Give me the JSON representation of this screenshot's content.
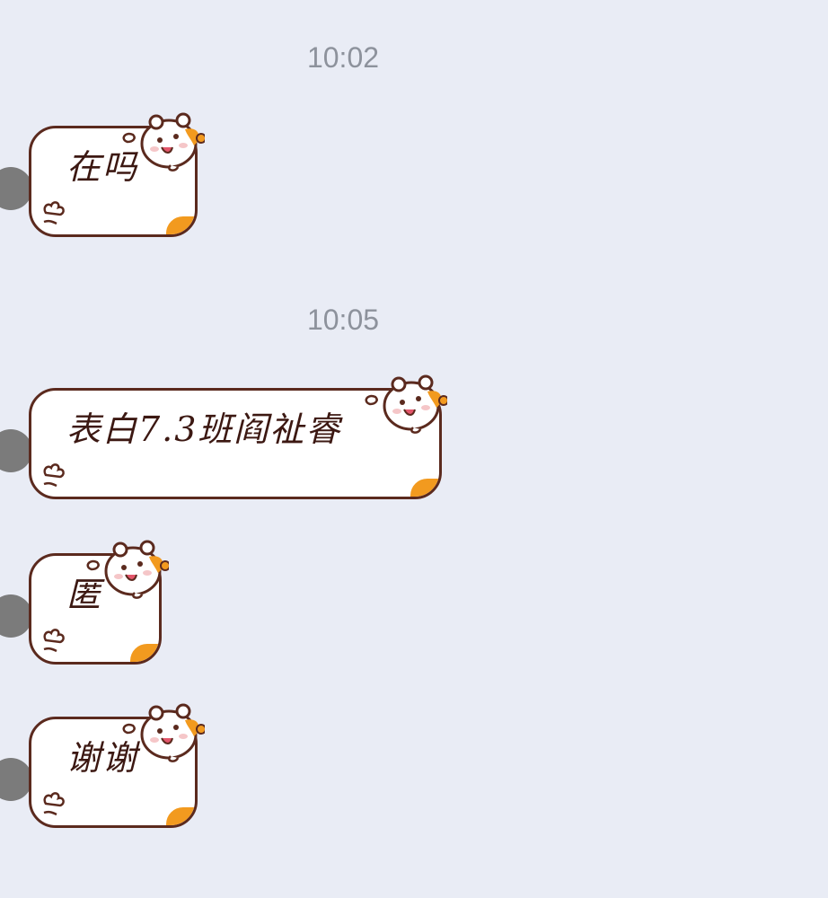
{
  "chat": {
    "messages": [
      {
        "time": "10:02",
        "text": "在吗"
      },
      {
        "time": "10:05",
        "text": "表白7.3班阎祉睿"
      },
      {
        "text": "匿"
      },
      {
        "text": "谢谢"
      }
    ]
  },
  "theme": {
    "background": "#e9ecf5",
    "bubble_border": "#5b2a1e",
    "bubble_fill": "#ffffff",
    "hamster_accent": "#f29a1f",
    "timestamp_color": "#8d929c",
    "avatar_color": "#7b7b7b"
  },
  "icons": {
    "bubble_decoration": "hamster-icon",
    "avatar": "avatar"
  }
}
